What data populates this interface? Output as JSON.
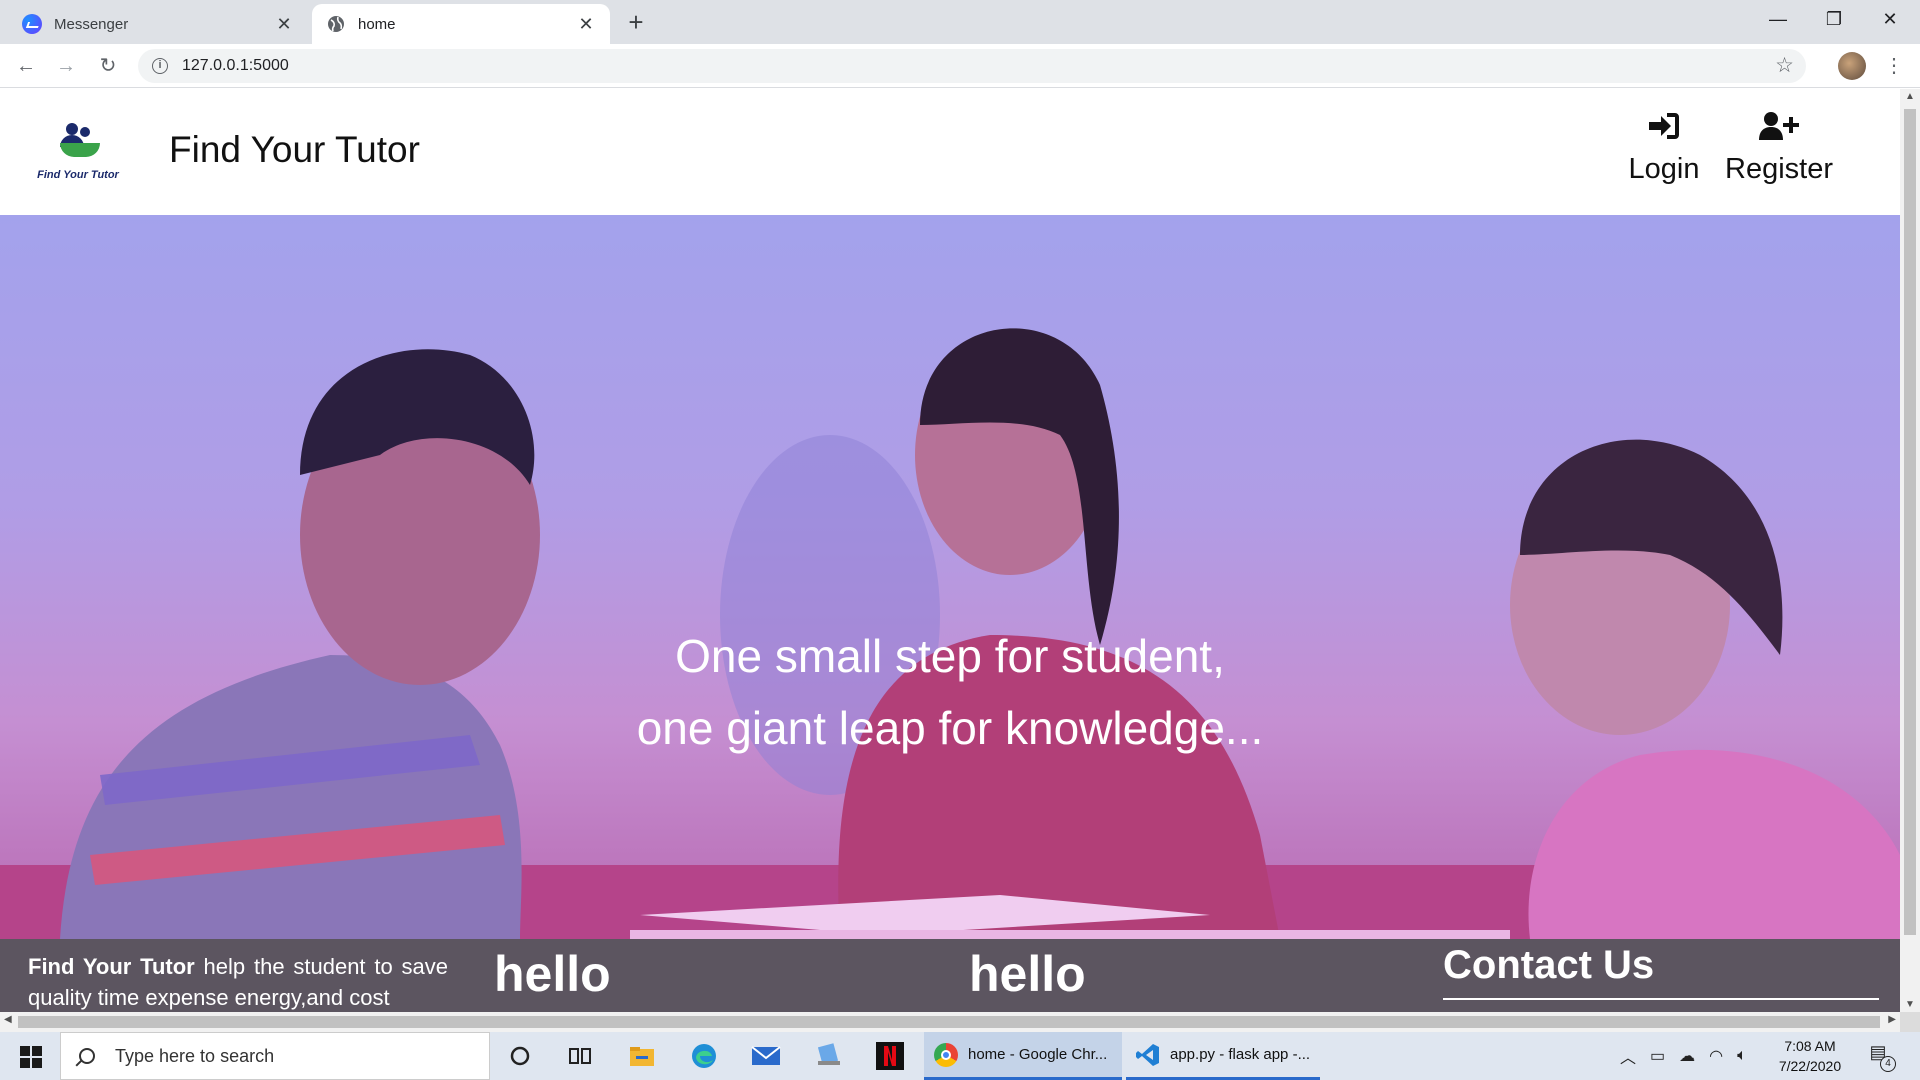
{
  "browser": {
    "tabs": [
      {
        "title": "Messenger",
        "icon": "messenger-icon",
        "active": false
      },
      {
        "title": "home",
        "icon": "globe-icon",
        "active": true
      }
    ],
    "new_tab_icon": "+",
    "url": "127.0.0.1:5000",
    "window_controls": {
      "minimize": "—",
      "maximize": "❐",
      "close": "✕"
    }
  },
  "site": {
    "logo_text": "Find Your Tutor",
    "title": "Find Your Tutor",
    "nav": {
      "login": "Login",
      "register": "Register"
    },
    "hero": {
      "line1": "One small step for student,",
      "line2": "one giant leap for knowledge..."
    },
    "footer": {
      "about_brand": "Find Your Tutor",
      "about_text": " help the student to save quality time expense energy,and cost",
      "heading_1": "hello",
      "heading_2": "hello",
      "contact_heading": "Contact Us"
    }
  },
  "taskbar": {
    "search_placeholder": "Type here to search",
    "apps": [
      {
        "label": "home - Google Chr...",
        "icon": "chrome-icon"
      },
      {
        "label": "app.py - flask app -...",
        "icon": "vscode-icon"
      }
    ],
    "clock_time": "7:08 AM",
    "clock_date": "7/22/2020",
    "notification_count": "4"
  },
  "colors": {
    "hero_tint": "#a3a2ec",
    "footer_bg": "#5c5560",
    "accent_blue": "#2a6acb"
  }
}
